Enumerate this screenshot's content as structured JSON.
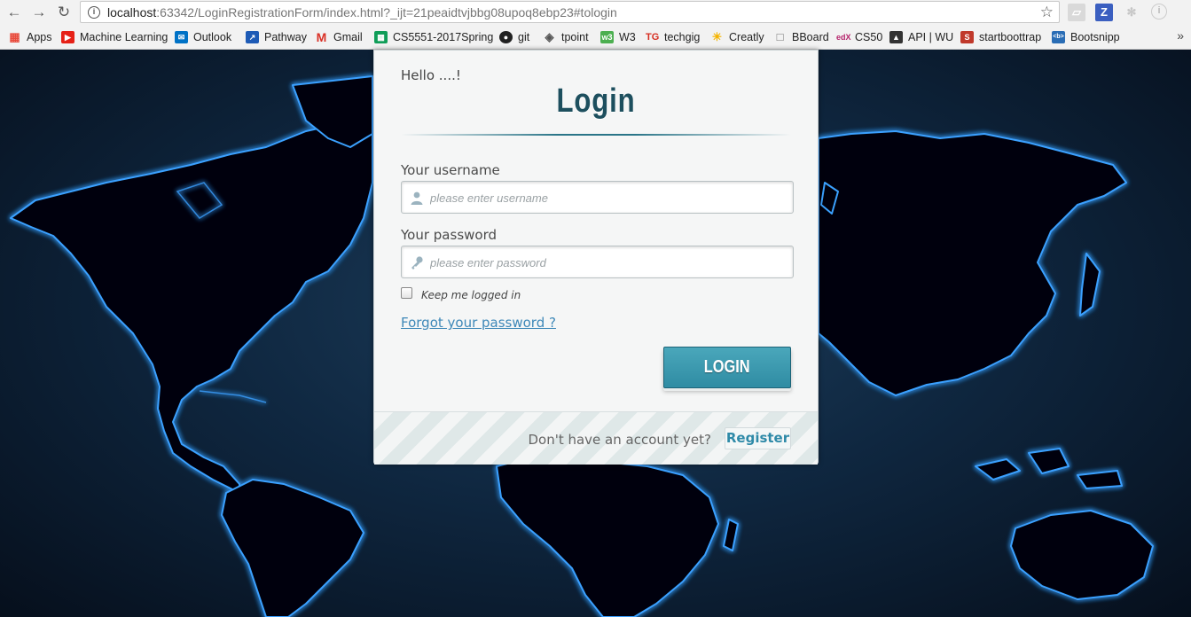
{
  "browser": {
    "url_host": "localhost",
    "url_path": ":63342/LoginRegistrationForm/index.html?_ijt=21peaidtvjbbg08upoq8ebp23#tologin",
    "bookmarks": [
      {
        "label": "Apps",
        "icon": "apps-grid-icon",
        "color": "#e84b3c"
      },
      {
        "label": "Machine Learning",
        "icon": "youtube-icon",
        "color": "#e62117"
      },
      {
        "label": "Outlook",
        "icon": "outlook-icon",
        "color": "#0072c6"
      },
      {
        "label": "Pathway",
        "icon": "pathway-icon",
        "color": "#1e5bb6"
      },
      {
        "label": "Gmail",
        "icon": "gmail-icon",
        "color": "#d93025"
      },
      {
        "label": "CS5551-2017Spring",
        "icon": "sheets-icon",
        "color": "#0f9d58"
      },
      {
        "label": "git",
        "icon": "github-icon",
        "color": "#222222"
      },
      {
        "label": "tpoint",
        "icon": "tpoint-icon",
        "color": "#555555"
      },
      {
        "label": "W3",
        "icon": "w3-icon",
        "color": "#4caf50"
      },
      {
        "label": "techgig",
        "icon": "techgig-icon",
        "color": "#d62d20"
      },
      {
        "label": "Creatly",
        "icon": "bulb-icon",
        "color": "#f5b400"
      },
      {
        "label": "BBoard",
        "icon": "page-icon",
        "color": "#888888"
      },
      {
        "label": "CS50",
        "icon": "edx-icon",
        "color": "#02262b"
      },
      {
        "label": "API | WU",
        "icon": "wu-icon",
        "color": "#333333"
      },
      {
        "label": "startboottrap",
        "icon": "startbootstrap-icon",
        "color": "#c0392b"
      },
      {
        "label": "Bootsnipp",
        "icon": "bootsnipp-icon",
        "color": "#2a6db5"
      }
    ]
  },
  "login": {
    "greeting": "Hello ....!",
    "title": "Login",
    "username_label": "Your username",
    "username_placeholder": "please enter username",
    "password_label": "Your password",
    "password_placeholder": "please enter password",
    "keep_logged_in": "Keep me logged in",
    "forgot": "Forgot your password ?",
    "submit": "LOGIN",
    "no_account": "Don't have an account yet?",
    "register": "Register"
  },
  "colors": {
    "accent": "#2f8ca3",
    "link": "#3e88b8",
    "title": "#1d4f5e",
    "map_glow": "#2f8fe8"
  }
}
